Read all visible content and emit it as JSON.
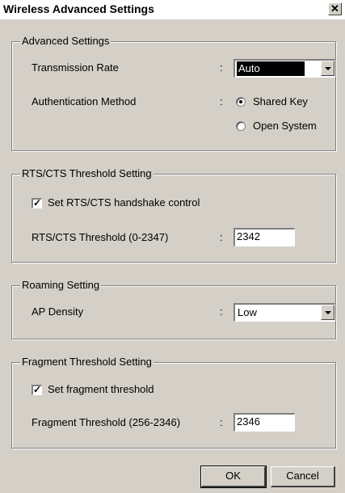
{
  "window": {
    "title": "Wireless Advanced Settings",
    "close_label": "✕"
  },
  "advanced": {
    "legend": "Advanced Settings",
    "transmission_rate_label": "Transmission Rate",
    "transmission_rate_value": "Auto",
    "auth_method_label": "Authentication Method",
    "auth_options": [
      "Shared Key",
      "Open System"
    ],
    "auth_selected": "Shared Key",
    "colon": ":"
  },
  "rts": {
    "legend": "RTS/CTS Threshold Setting",
    "checkbox_label": "Set RTS/CTS handshake control",
    "checkbox_checked": true,
    "threshold_label": "RTS/CTS Threshold (0-2347)",
    "threshold_value": "2342",
    "colon": ":"
  },
  "roaming": {
    "legend": "Roaming Setting",
    "density_label": "AP Density",
    "density_value": "Low",
    "colon": ":"
  },
  "fragment": {
    "legend": "Fragment Threshold Setting",
    "checkbox_label": "Set fragment threshold",
    "checkbox_checked": true,
    "threshold_label": "Fragment Threshold (256-2346)",
    "threshold_value": "2346",
    "colon": ":"
  },
  "footer": {
    "ok_label": "OK",
    "cancel_label": "Cancel"
  }
}
